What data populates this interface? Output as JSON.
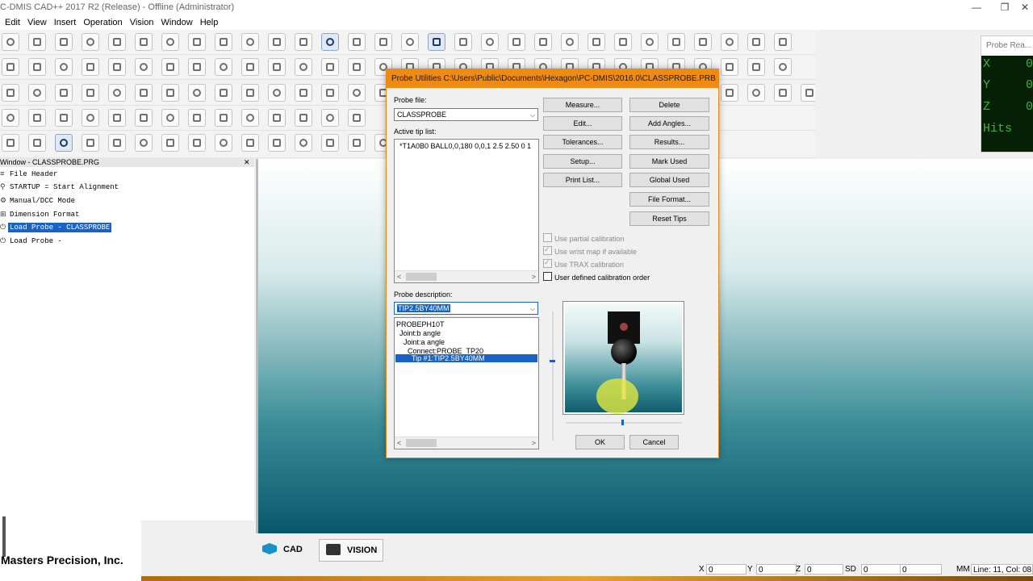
{
  "app": {
    "title": "C-DMIS CAD++ 2017 R2 (Release) - Offline (Administrator)",
    "window_buttons": [
      "—",
      "❐",
      "✕"
    ]
  },
  "menu": [
    "Edit",
    "View",
    "Insert",
    "Operation",
    "Vision",
    "Window",
    "Help"
  ],
  "probe_readout": {
    "title": "Probe Rea...",
    "lines": [
      "X",
      "Y",
      "Z",
      "Hits"
    ],
    "values": [
      "0.",
      "0.",
      "0.",
      ""
    ]
  },
  "edit_window": {
    "title": "Window - CLASSPROBE.PRG",
    "close": "✕",
    "items": [
      {
        "icon": "≡",
        "label": "File Header"
      },
      {
        "icon": "⚲",
        "label": "STARTUP = Start Alignment"
      },
      {
        "icon": "⚙",
        "label": "Manual/DCC Mode"
      },
      {
        "icon": "⊞",
        "label": "Dimension Format"
      },
      {
        "icon": "⏻",
        "label": "Load Probe - CLASSPROBE"
      },
      {
        "icon": "⏻",
        "label": "Load Probe -"
      }
    ],
    "selected_index": 4
  },
  "logo": {
    "text": "Masters Precision, Inc."
  },
  "tabs": {
    "cad": "CAD",
    "vision": "VISION"
  },
  "status": {
    "x_label": "X",
    "x_value": "0",
    "y_label": "Y",
    "y_value": "0",
    "z_label": "Z",
    "z_value": "0",
    "sd_label": "SD",
    "sd_value": "0",
    "extra_value": "0",
    "units": "MM",
    "position": "Line: 11, Col: 08"
  },
  "dialog": {
    "title": "Probe Utilities  C:\\Users\\Public\\Documents\\Hexagon\\PC-DMIS\\2016.0\\CLASSPROBE.PRB",
    "probe_file_label": "Probe file:",
    "probe_file_value": "CLASSPROBE",
    "active_tip_label": "Active tip list:",
    "active_tip_row": "*T1A0B0 BALL0,0,180 0,0,1 2.5 2.50 0 1",
    "probe_desc_label": "Probe description:",
    "probe_desc_value": "TIP2.5BY40MM",
    "buttons_left": [
      "Measure...",
      "Edit...",
      "Tolerances...",
      "Setup...",
      "Print List..."
    ],
    "buttons_right": [
      "Delete",
      "Add Angles...",
      "Results...",
      "Mark Used",
      "Global Used",
      "File Format...",
      "Reset Tips"
    ],
    "checkboxes": [
      {
        "label": "Use partial calibration",
        "checked": false,
        "enabled": false
      },
      {
        "label": "Use wrist map if available",
        "checked": true,
        "enabled": false
      },
      {
        "label": "Use TRAX calibration",
        "checked": true,
        "enabled": false
      },
      {
        "label": "User defined calibration order",
        "checked": false,
        "enabled": true
      }
    ],
    "tree": [
      {
        "label": "PROBEPH10T",
        "depth": 0
      },
      {
        "label": "Joint:b angle",
        "depth": 1
      },
      {
        "label": "Joint:a angle",
        "depth": 2
      },
      {
        "label": "Connect:PROBE_TP20",
        "depth": 3
      },
      {
        "label": "Tip #1:TIP2.5BY40MM",
        "depth": 4
      }
    ],
    "ok": "OK",
    "cancel": "Cancel"
  },
  "colors": {
    "dialog_accent": "#ef8a12",
    "selection": "#1a63c6",
    "readout_bg": "#062006",
    "readout_text": "#44b044"
  }
}
